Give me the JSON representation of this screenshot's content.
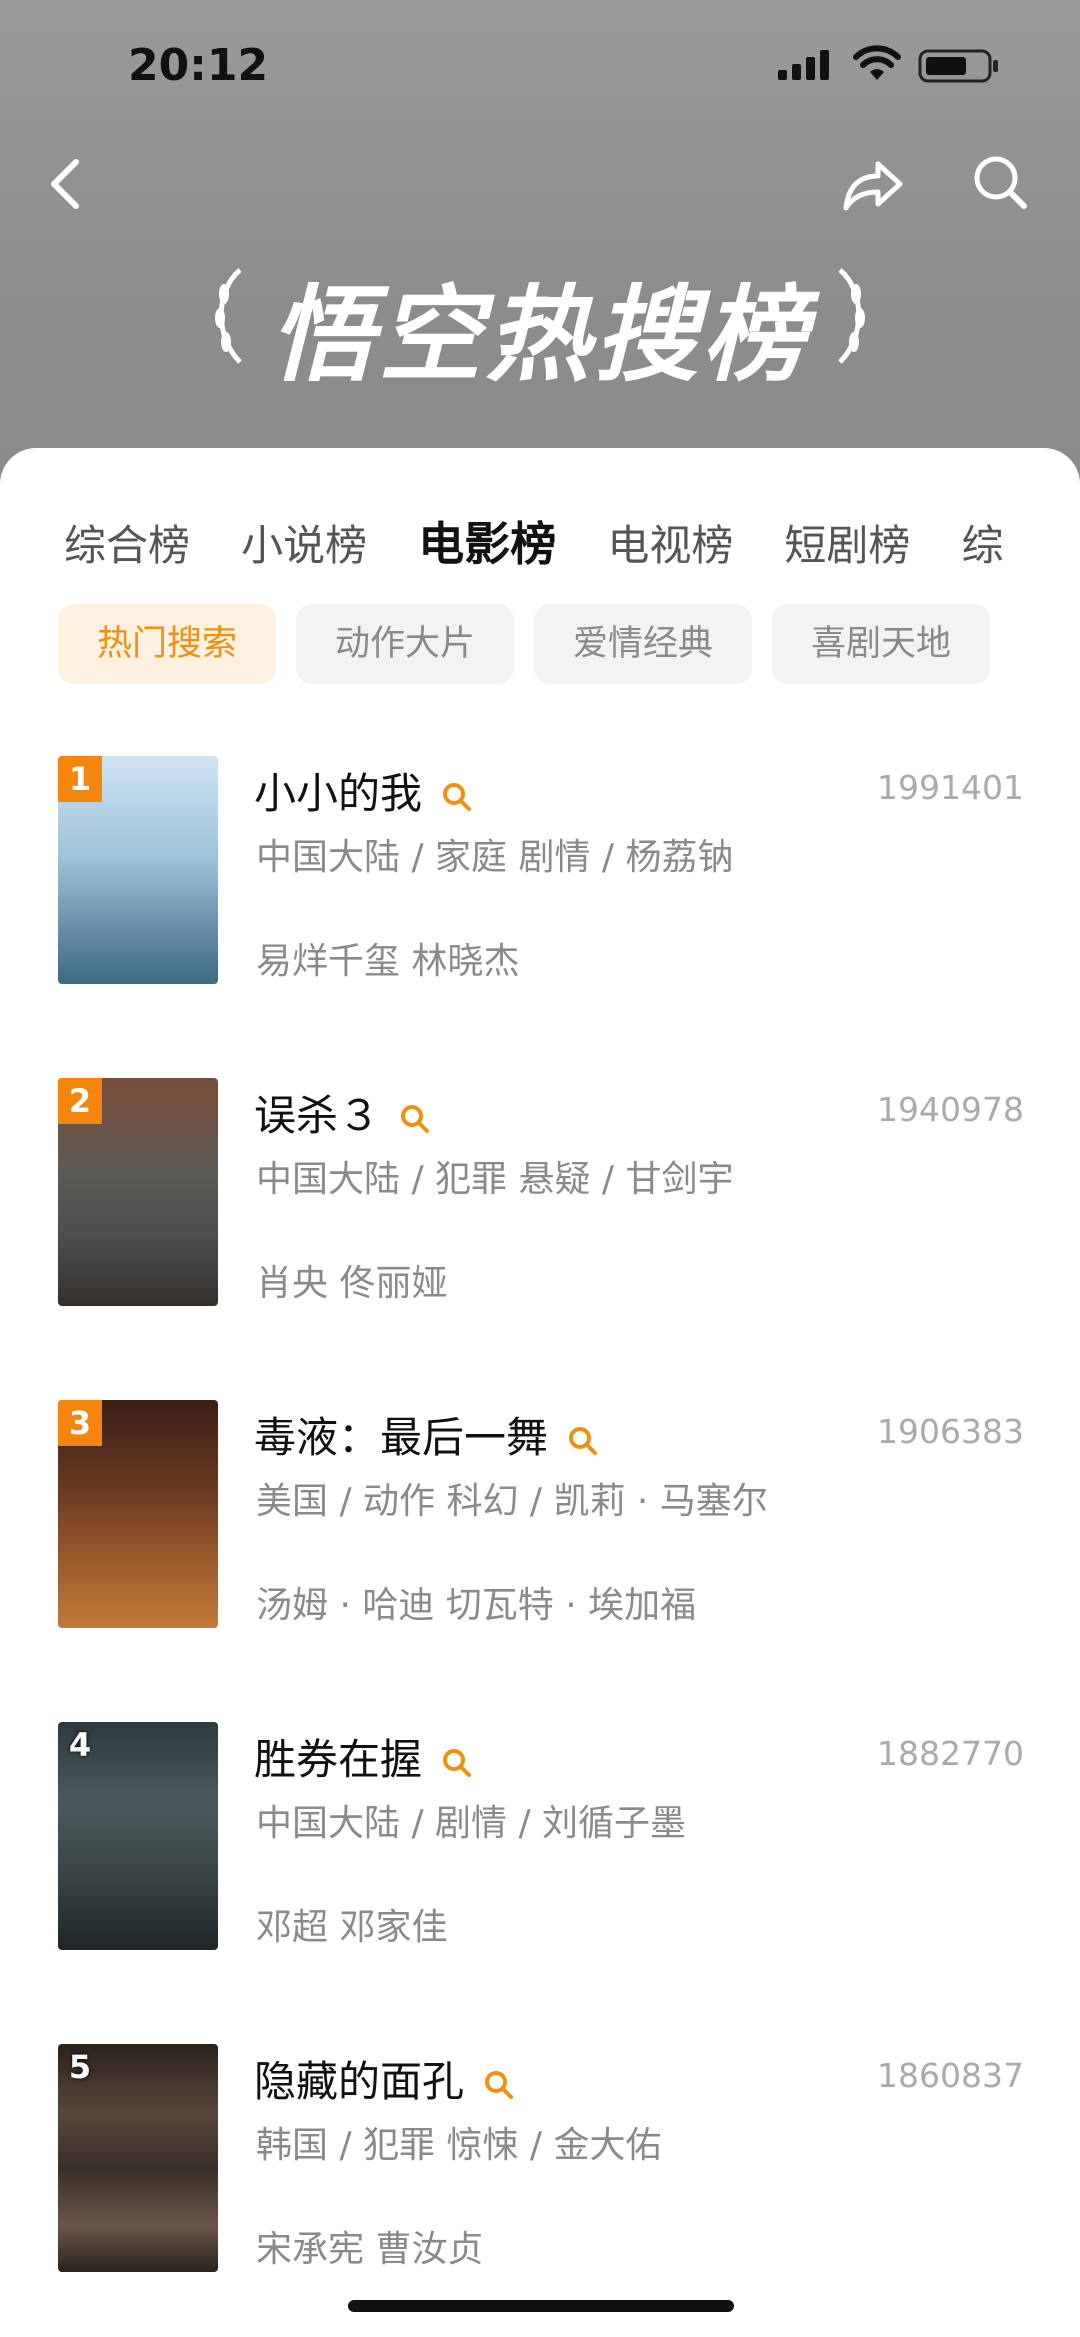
{
  "status": {
    "time": "20:12"
  },
  "header": {
    "title": "悟空热搜榜"
  },
  "tabs": [
    "综合榜",
    "小说榜",
    "电影榜",
    "电视榜",
    "短剧榜",
    "综"
  ],
  "active_tab": 2,
  "chips": [
    "热门搜索",
    "动作大片",
    "爱情经典",
    "喜剧天地"
  ],
  "active_chip": 0,
  "colors": {
    "accent": "#f0900e",
    "rank_badge": "#f4860e"
  },
  "movies": [
    {
      "rank": "1",
      "title": "小小的我",
      "score": "1991401",
      "meta": "中国大陆 / 家庭 剧情 / 杨荔钠",
      "cast": "易烊千玺  林晓杰"
    },
    {
      "rank": "2",
      "title": "误杀３",
      "score": "1940978",
      "meta": "中国大陆 / 犯罪 悬疑 / 甘剑宇",
      "cast": "肖央  佟丽娅"
    },
    {
      "rank": "3",
      "title": "毒液：最后一舞",
      "score": "1906383",
      "meta": "美国 / 动作 科幻 / 凯莉 · 马塞尔",
      "cast": "汤姆 · 哈迪    切瓦特 · 埃加福"
    },
    {
      "rank": "4",
      "title": "胜券在握",
      "score": "1882770",
      "meta": "中国大陆 / 剧情 / 刘循子墨",
      "cast": "邓超  邓家佳"
    },
    {
      "rank": "5",
      "title": "隐藏的面孔",
      "score": "1860837",
      "meta": "韩国 / 犯罪 惊悚 / 金大佑",
      "cast": "宋承宪  曹汝贞"
    }
  ]
}
